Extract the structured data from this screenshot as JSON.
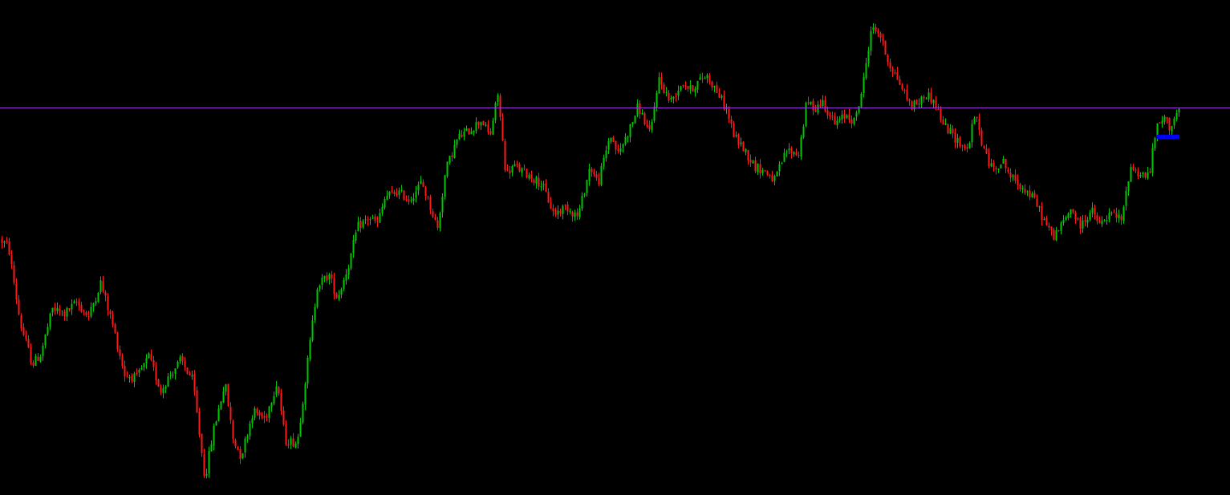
{
  "chart_data": {
    "type": "candlestick",
    "title": "",
    "xlabel": "",
    "ylabel": "",
    "grid": false,
    "ylim": [
      0,
      617
    ],
    "colors": {
      "background": "#000000",
      "bull": "#00c800",
      "bear": "#ff1a1a",
      "level_line": "#9b30d9",
      "marker": "#0000ff"
    },
    "horizontal_level": 483,
    "marker_level": 447,
    "path": [
      [
        0,
        318
      ],
      [
        10,
        310
      ],
      [
        25,
        213
      ],
      [
        40,
        163
      ],
      [
        50,
        175
      ],
      [
        65,
        232
      ],
      [
        80,
        226
      ],
      [
        95,
        240
      ],
      [
        110,
        222
      ],
      [
        125,
        265
      ],
      [
        140,
        212
      ],
      [
        155,
        150
      ],
      [
        170,
        146
      ],
      [
        185,
        172
      ],
      [
        200,
        130
      ],
      [
        210,
        148
      ],
      [
        225,
        168
      ],
      [
        240,
        142
      ],
      [
        255,
        20
      ],
      [
        265,
        78
      ],
      [
        280,
        140
      ],
      [
        290,
        70
      ],
      [
        300,
        48
      ],
      [
        315,
        105
      ],
      [
        330,
        95
      ],
      [
        345,
        142
      ],
      [
        355,
        68
      ],
      [
        370,
        65
      ],
      [
        385,
        182
      ],
      [
        395,
        262
      ],
      [
        410,
        274
      ],
      [
        420,
        245
      ],
      [
        435,
        290
      ],
      [
        445,
        334
      ],
      [
        460,
        346
      ],
      [
        470,
        338
      ],
      [
        480,
        372
      ],
      [
        495,
        378
      ],
      [
        510,
        368
      ],
      [
        525,
        390
      ],
      [
        535,
        362
      ],
      [
        545,
        332
      ],
      [
        555,
        405
      ],
      [
        570,
        445
      ],
      [
        585,
        455
      ],
      [
        600,
        468
      ],
      [
        610,
        446
      ],
      [
        620,
        500
      ],
      [
        630,
        400
      ],
      [
        640,
        410
      ],
      [
        660,
        398
      ],
      [
        675,
        387
      ],
      [
        690,
        350
      ],
      [
        705,
        360
      ],
      [
        720,
        347
      ],
      [
        735,
        410
      ],
      [
        745,
        388
      ],
      [
        760,
        450
      ],
      [
        770,
        425
      ],
      [
        785,
        458
      ],
      [
        795,
        485
      ],
      [
        810,
        448
      ],
      [
        820,
        520
      ],
      [
        835,
        490
      ],
      [
        850,
        515
      ],
      [
        860,
        505
      ],
      [
        870,
        515
      ],
      [
        880,
        524
      ],
      [
        895,
        500
      ],
      [
        905,
        480
      ],
      [
        915,
        446
      ],
      [
        925,
        434
      ],
      [
        940,
        410
      ],
      [
        955,
        402
      ],
      [
        965,
        392
      ],
      [
        980,
        430
      ],
      [
        995,
        425
      ],
      [
        1005,
        490
      ],
      [
        1015,
        482
      ],
      [
        1025,
        490
      ],
      [
        1040,
        462
      ],
      [
        1055,
        474
      ],
      [
        1065,
        465
      ],
      [
        1075,
        510
      ],
      [
        1085,
        580
      ],
      [
        1095,
        578
      ],
      [
        1105,
        544
      ],
      [
        1120,
        515
      ],
      [
        1135,
        485
      ],
      [
        1145,
        490
      ],
      [
        1155,
        500
      ],
      [
        1165,
        488
      ],
      [
        1175,
        462
      ],
      [
        1190,
        445
      ],
      [
        1205,
        430
      ],
      [
        1215,
        475
      ],
      [
        1225,
        432
      ],
      [
        1235,
        408
      ],
      [
        1250,
        415
      ],
      [
        1260,
        395
      ],
      [
        1275,
        383
      ],
      [
        1290,
        366
      ],
      [
        1300,
        344
      ],
      [
        1312,
        322
      ],
      [
        1322,
        335
      ],
      [
        1335,
        358
      ],
      [
        1345,
        334
      ],
      [
        1360,
        355
      ],
      [
        1370,
        336
      ],
      [
        1385,
        351
      ],
      [
        1398,
        342
      ],
      [
        1408,
        410
      ],
      [
        1420,
        400
      ],
      [
        1432,
        398
      ],
      [
        1440,
        455
      ],
      [
        1450,
        470
      ],
      [
        1458,
        458
      ],
      [
        1465,
        475
      ],
      [
        1470,
        480
      ]
    ]
  }
}
